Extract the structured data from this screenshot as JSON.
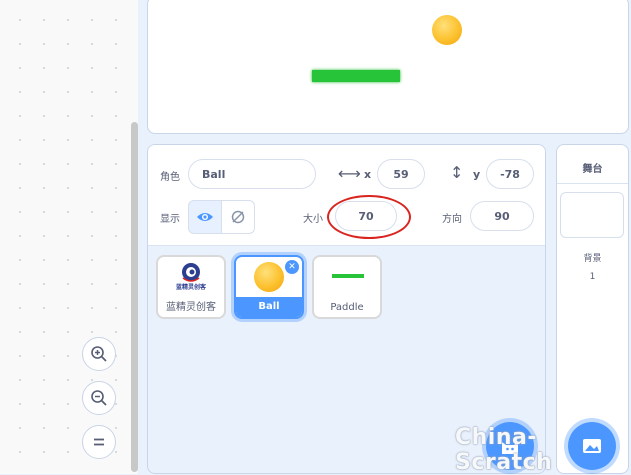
{
  "sprite_info": {
    "sprite_label": "角色",
    "sprite_name": "Ball",
    "x_label": "x",
    "x_value": "59",
    "y_label": "y",
    "y_value": "-78",
    "show_label": "显示",
    "size_label": "大小",
    "size_value": "70",
    "direction_label": "方向",
    "direction_value": "90"
  },
  "sprites": [
    {
      "name": "蓝精灵创客",
      "logo_text": "蓝精灵创客"
    },
    {
      "name": "Ball"
    },
    {
      "name": "Paddle"
    }
  ],
  "stage_panel": {
    "title": "舞台",
    "backdrop_label": "背景",
    "backdrop_count": "1"
  },
  "watermark": "China-Scratch",
  "colors": {
    "accent": "#4c97ff",
    "ball": "#fcc12e",
    "paddle": "#27c338",
    "highlight": "#d9251f"
  }
}
